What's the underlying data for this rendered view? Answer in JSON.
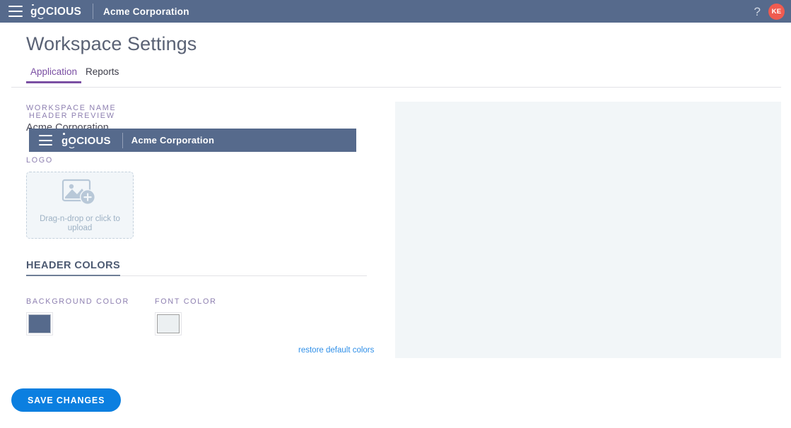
{
  "header": {
    "menu_icon": "hamburger-menu-icon",
    "logo_text": "OCIOUS",
    "logo_lead": "g",
    "logo_full": "gOCIOUS",
    "workspace_title": "Acme Corporation",
    "help_icon": "?",
    "avatar_initials": "KE",
    "background_color": "#566a8c",
    "font_color": "#ffffff",
    "avatar_color": "#ef5b50"
  },
  "page": {
    "title": "Workspace Settings"
  },
  "tabs": [
    {
      "label": "Application",
      "active": true
    },
    {
      "label": "Reports",
      "active": false
    }
  ],
  "form": {
    "workspace_name_label": "WORKSPACE NAME",
    "workspace_name_value": "Acme Corporation",
    "logo_label": "LOGO",
    "dropzone_text": "Drag-n-drop or click to upload",
    "dropzone_icon": "image-plus-icon"
  },
  "header_colors": {
    "section_title": "HEADER COLORS",
    "background_color_label": "BACKGROUND COLOR",
    "background_color_value": "#566a8c",
    "font_color_label": "FONT COLOR",
    "font_color_value": "#ecf0f2",
    "restore_link": "restore default colors",
    "restore_link_color": "#2f8fe8"
  },
  "preview": {
    "label": "HEADER PREVIEW",
    "menu_icon": "hamburger-menu-icon",
    "logo_lead": "g",
    "logo_text": "OCIOUS",
    "workspace_title": "Acme Corporation",
    "panel_background": "#f2f6f8",
    "bar_background": "#566a8c"
  },
  "actions": {
    "save_label": "SAVE CHANGES",
    "save_color": "#0b7fe0"
  }
}
